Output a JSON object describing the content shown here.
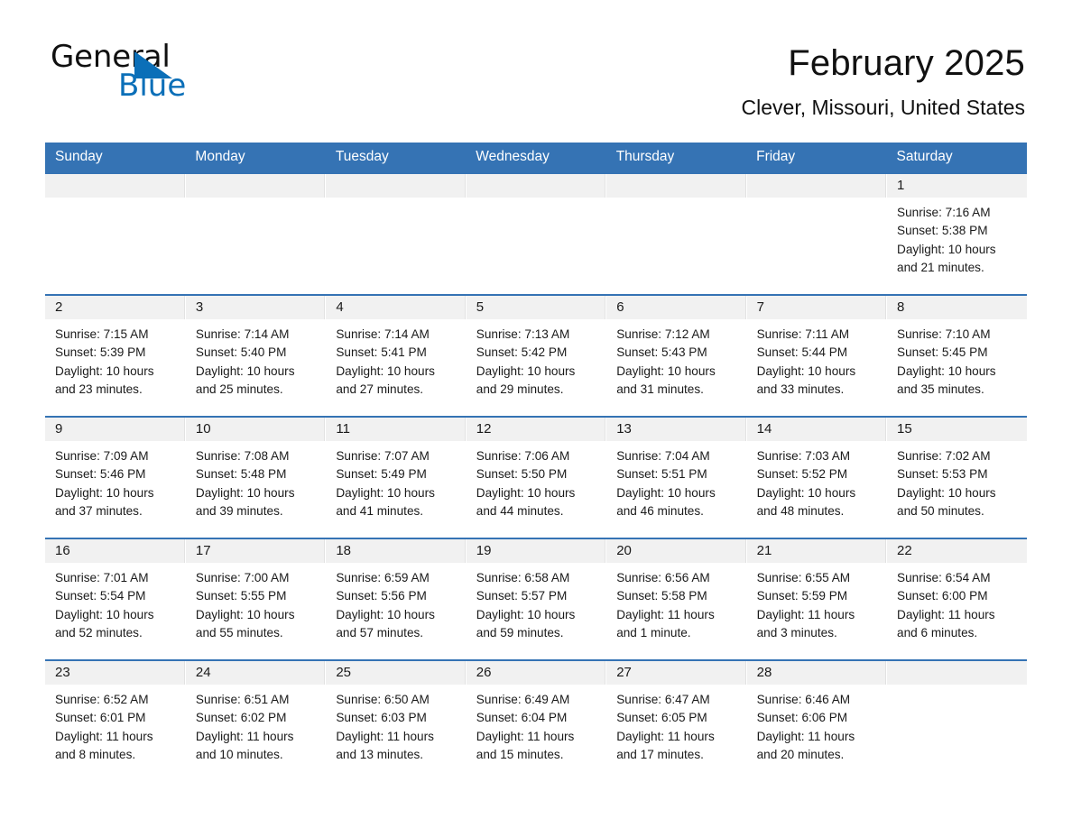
{
  "logo": {
    "word_one": "General",
    "word_two": "Blue",
    "triangle_color": "#0b6fb8"
  },
  "header": {
    "title": "February 2025",
    "subtitle": "Clever, Missouri, United States"
  },
  "theme": {
    "header_blue": "#3573b4",
    "daynum_band": "#f1f1f1",
    "text": "#1a1a1a"
  },
  "weekday_headers": [
    "Sunday",
    "Monday",
    "Tuesday",
    "Wednesday",
    "Thursday",
    "Friday",
    "Saturday"
  ],
  "weeks": [
    [
      {
        "day": "",
        "blank": true
      },
      {
        "day": "",
        "blank": true
      },
      {
        "day": "",
        "blank": true
      },
      {
        "day": "",
        "blank": true
      },
      {
        "day": "",
        "blank": true
      },
      {
        "day": "",
        "blank": true
      },
      {
        "day": "1",
        "sunrise": "Sunrise: 7:16 AM",
        "sunset": "Sunset: 5:38 PM",
        "daylight_line1": "Daylight: 10 hours",
        "daylight_line2": "and 21 minutes."
      }
    ],
    [
      {
        "day": "2",
        "sunrise": "Sunrise: 7:15 AM",
        "sunset": "Sunset: 5:39 PM",
        "daylight_line1": "Daylight: 10 hours",
        "daylight_line2": "and 23 minutes."
      },
      {
        "day": "3",
        "sunrise": "Sunrise: 7:14 AM",
        "sunset": "Sunset: 5:40 PM",
        "daylight_line1": "Daylight: 10 hours",
        "daylight_line2": "and 25 minutes."
      },
      {
        "day": "4",
        "sunrise": "Sunrise: 7:14 AM",
        "sunset": "Sunset: 5:41 PM",
        "daylight_line1": "Daylight: 10 hours",
        "daylight_line2": "and 27 minutes."
      },
      {
        "day": "5",
        "sunrise": "Sunrise: 7:13 AM",
        "sunset": "Sunset: 5:42 PM",
        "daylight_line1": "Daylight: 10 hours",
        "daylight_line2": "and 29 minutes."
      },
      {
        "day": "6",
        "sunrise": "Sunrise: 7:12 AM",
        "sunset": "Sunset: 5:43 PM",
        "daylight_line1": "Daylight: 10 hours",
        "daylight_line2": "and 31 minutes."
      },
      {
        "day": "7",
        "sunrise": "Sunrise: 7:11 AM",
        "sunset": "Sunset: 5:44 PM",
        "daylight_line1": "Daylight: 10 hours",
        "daylight_line2": "and 33 minutes."
      },
      {
        "day": "8",
        "sunrise": "Sunrise: 7:10 AM",
        "sunset": "Sunset: 5:45 PM",
        "daylight_line1": "Daylight: 10 hours",
        "daylight_line2": "and 35 minutes."
      }
    ],
    [
      {
        "day": "9",
        "sunrise": "Sunrise: 7:09 AM",
        "sunset": "Sunset: 5:46 PM",
        "daylight_line1": "Daylight: 10 hours",
        "daylight_line2": "and 37 minutes."
      },
      {
        "day": "10",
        "sunrise": "Sunrise: 7:08 AM",
        "sunset": "Sunset: 5:48 PM",
        "daylight_line1": "Daylight: 10 hours",
        "daylight_line2": "and 39 minutes."
      },
      {
        "day": "11",
        "sunrise": "Sunrise: 7:07 AM",
        "sunset": "Sunset: 5:49 PM",
        "daylight_line1": "Daylight: 10 hours",
        "daylight_line2": "and 41 minutes."
      },
      {
        "day": "12",
        "sunrise": "Sunrise: 7:06 AM",
        "sunset": "Sunset: 5:50 PM",
        "daylight_line1": "Daylight: 10 hours",
        "daylight_line2": "and 44 minutes."
      },
      {
        "day": "13",
        "sunrise": "Sunrise: 7:04 AM",
        "sunset": "Sunset: 5:51 PM",
        "daylight_line1": "Daylight: 10 hours",
        "daylight_line2": "and 46 minutes."
      },
      {
        "day": "14",
        "sunrise": "Sunrise: 7:03 AM",
        "sunset": "Sunset: 5:52 PM",
        "daylight_line1": "Daylight: 10 hours",
        "daylight_line2": "and 48 minutes."
      },
      {
        "day": "15",
        "sunrise": "Sunrise: 7:02 AM",
        "sunset": "Sunset: 5:53 PM",
        "daylight_line1": "Daylight: 10 hours",
        "daylight_line2": "and 50 minutes."
      }
    ],
    [
      {
        "day": "16",
        "sunrise": "Sunrise: 7:01 AM",
        "sunset": "Sunset: 5:54 PM",
        "daylight_line1": "Daylight: 10 hours",
        "daylight_line2": "and 52 minutes."
      },
      {
        "day": "17",
        "sunrise": "Sunrise: 7:00 AM",
        "sunset": "Sunset: 5:55 PM",
        "daylight_line1": "Daylight: 10 hours",
        "daylight_line2": "and 55 minutes."
      },
      {
        "day": "18",
        "sunrise": "Sunrise: 6:59 AM",
        "sunset": "Sunset: 5:56 PM",
        "daylight_line1": "Daylight: 10 hours",
        "daylight_line2": "and 57 minutes."
      },
      {
        "day": "19",
        "sunrise": "Sunrise: 6:58 AM",
        "sunset": "Sunset: 5:57 PM",
        "daylight_line1": "Daylight: 10 hours",
        "daylight_line2": "and 59 minutes."
      },
      {
        "day": "20",
        "sunrise": "Sunrise: 6:56 AM",
        "sunset": "Sunset: 5:58 PM",
        "daylight_line1": "Daylight: 11 hours",
        "daylight_line2": "and 1 minute."
      },
      {
        "day": "21",
        "sunrise": "Sunrise: 6:55 AM",
        "sunset": "Sunset: 5:59 PM",
        "daylight_line1": "Daylight: 11 hours",
        "daylight_line2": "and 3 minutes."
      },
      {
        "day": "22",
        "sunrise": "Sunrise: 6:54 AM",
        "sunset": "Sunset: 6:00 PM",
        "daylight_line1": "Daylight: 11 hours",
        "daylight_line2": "and 6 minutes."
      }
    ],
    [
      {
        "day": "23",
        "sunrise": "Sunrise: 6:52 AM",
        "sunset": "Sunset: 6:01 PM",
        "daylight_line1": "Daylight: 11 hours",
        "daylight_line2": "and 8 minutes."
      },
      {
        "day": "24",
        "sunrise": "Sunrise: 6:51 AM",
        "sunset": "Sunset: 6:02 PM",
        "daylight_line1": "Daylight: 11 hours",
        "daylight_line2": "and 10 minutes."
      },
      {
        "day": "25",
        "sunrise": "Sunrise: 6:50 AM",
        "sunset": "Sunset: 6:03 PM",
        "daylight_line1": "Daylight: 11 hours",
        "daylight_line2": "and 13 minutes."
      },
      {
        "day": "26",
        "sunrise": "Sunrise: 6:49 AM",
        "sunset": "Sunset: 6:04 PM",
        "daylight_line1": "Daylight: 11 hours",
        "daylight_line2": "and 15 minutes."
      },
      {
        "day": "27",
        "sunrise": "Sunrise: 6:47 AM",
        "sunset": "Sunset: 6:05 PM",
        "daylight_line1": "Daylight: 11 hours",
        "daylight_line2": "and 17 minutes."
      },
      {
        "day": "28",
        "sunrise": "Sunrise: 6:46 AM",
        "sunset": "Sunset: 6:06 PM",
        "daylight_line1": "Daylight: 11 hours",
        "daylight_line2": "and 20 minutes."
      },
      {
        "day": "",
        "blank": true
      }
    ]
  ]
}
